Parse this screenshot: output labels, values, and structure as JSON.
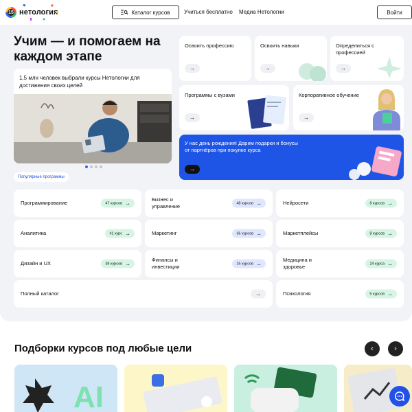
{
  "header": {
    "logo_badge": "15",
    "logo_text": "нетология",
    "catalog_label": "Каталог курсов",
    "nav": [
      "Учиться бесплатно",
      "Медиа Нетологии"
    ],
    "login_label": "Войти"
  },
  "hero": {
    "title": "Учим — и помогаем на каждом этапе",
    "promo_text": "1,5 млн человек выбрали курсы Нетологии для достижения своих целей",
    "popular_tag": "Популярные программы",
    "tiles": [
      {
        "label": "Освоить профессию"
      },
      {
        "label": "Освоить навыки"
      },
      {
        "label": "Определиться с профессией"
      },
      {
        "label": "Программы с вузами"
      },
      {
        "label": "Корпоративное обучение"
      }
    ],
    "birthday_text": "У нас день рождения! Дарим подарки и бонусы от партнёров при покупке курса",
    "arrow": "→"
  },
  "categories": [
    {
      "label": "Программирование",
      "count": "47 курсов",
      "color": "green"
    },
    {
      "label": "Бизнес и управление",
      "count": "48 курсов",
      "color": "blue"
    },
    {
      "label": "Нейросети",
      "count": "8 курсов",
      "color": "green"
    },
    {
      "label": "Аналитика",
      "count": "41 курс",
      "color": "green"
    },
    {
      "label": "Маркетинг",
      "count": "36 курсов",
      "color": "blue"
    },
    {
      "label": "Маркетплейсы",
      "count": "8 курсов",
      "color": "green"
    },
    {
      "label": "Дизайн и UX",
      "count": "38 курсов",
      "color": "green"
    },
    {
      "label": "Финансы и инвестиции",
      "count": "15 курсов",
      "color": "blue"
    },
    {
      "label": "Медицина и здоровье",
      "count": "24 курса",
      "color": "green"
    },
    {
      "label": "Полный каталог",
      "count": "",
      "color": "gray"
    },
    {
      "label": "Психология",
      "count": "5 курсов",
      "color": "green"
    }
  ],
  "collections": {
    "title": "Подборки курсов под любые цели",
    "prev": "‹",
    "next": "›"
  },
  "colors": {
    "accent": "#2350e6",
    "green_pill": "#d7f5e5",
    "blue_pill": "#dfe7ff",
    "panel": "#f2f3f6"
  }
}
